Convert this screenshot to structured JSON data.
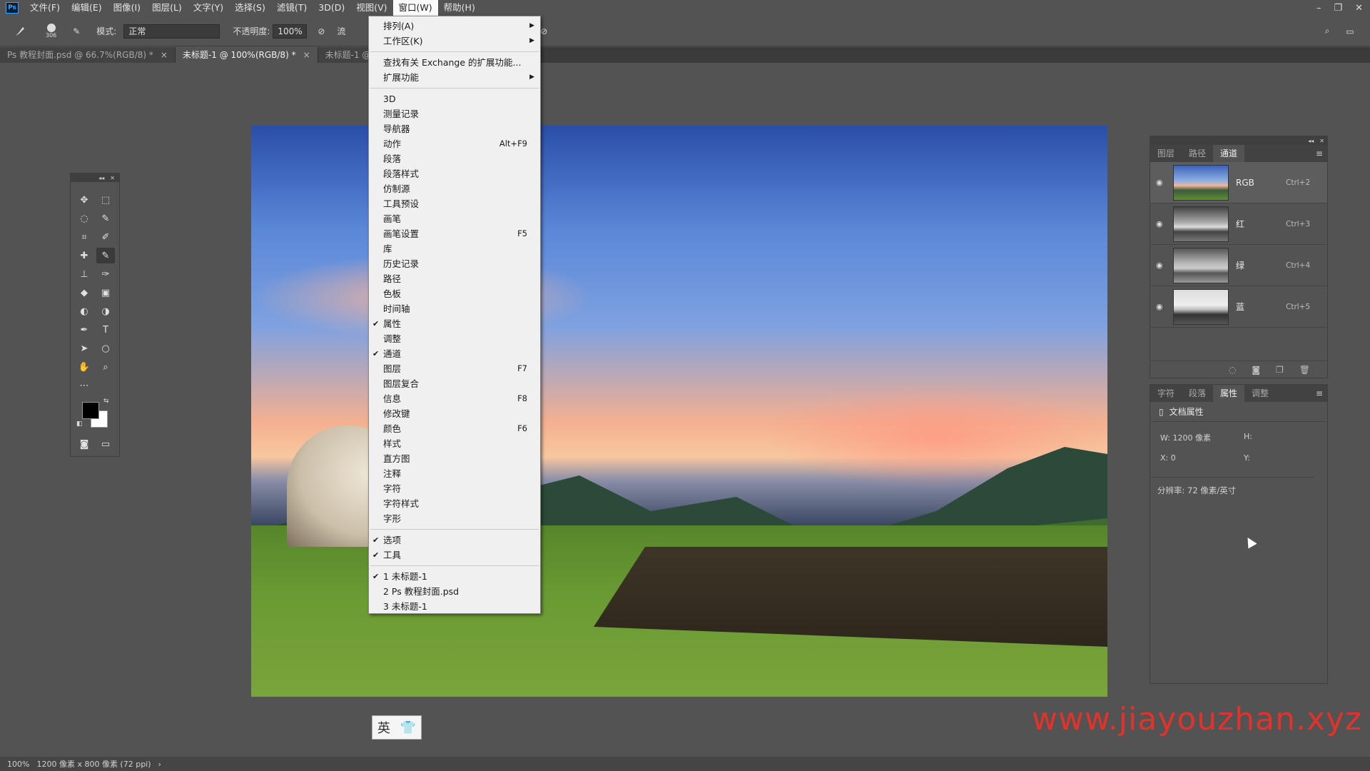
{
  "menubar": {
    "logo": "Ps",
    "items": [
      "文件(F)",
      "编辑(E)",
      "图像(I)",
      "图层(L)",
      "文字(Y)",
      "选择(S)",
      "滤镜(T)",
      "3D(D)",
      "视图(V)",
      "窗口(W)",
      "帮助(H)"
    ],
    "active_index": 9
  },
  "options": {
    "brush_size": "306",
    "mode_label": "模式:",
    "mode_value": "正常",
    "opacity_label": "不透明度:",
    "opacity_value": "100%",
    "flow_label": "流"
  },
  "tabs": [
    {
      "label": "Ps 教程封面.psd @ 66.7%(RGB/8) *",
      "active": false
    },
    {
      "label": "未标题-1 @ 100%(RGB/8) *",
      "active": true
    },
    {
      "label": "未标题-1 @ 10",
      "active": false
    }
  ],
  "dropdown": {
    "items": [
      {
        "label": "排列(A)",
        "submenu": true
      },
      {
        "label": "工作区(K)",
        "submenu": true
      },
      {
        "sep": true
      },
      {
        "label": "查找有关 Exchange 的扩展功能..."
      },
      {
        "label": "扩展功能",
        "submenu": true
      },
      {
        "sep": true
      },
      {
        "label": "3D"
      },
      {
        "label": "测量记录"
      },
      {
        "label": "导航器"
      },
      {
        "label": "动作",
        "shortcut": "Alt+F9"
      },
      {
        "label": "段落"
      },
      {
        "label": "段落样式"
      },
      {
        "label": "仿制源"
      },
      {
        "label": "工具预设"
      },
      {
        "label": "画笔"
      },
      {
        "label": "画笔设置",
        "shortcut": "F5"
      },
      {
        "label": "库"
      },
      {
        "label": "历史记录"
      },
      {
        "label": "路径"
      },
      {
        "label": "色板"
      },
      {
        "label": "时间轴"
      },
      {
        "label": "属性",
        "checked": true
      },
      {
        "label": "调整"
      },
      {
        "label": "通道",
        "checked": true
      },
      {
        "label": "图层",
        "shortcut": "F7"
      },
      {
        "label": "图层复合"
      },
      {
        "label": "信息",
        "shortcut": "F8"
      },
      {
        "label": "修改键"
      },
      {
        "label": "颜色",
        "shortcut": "F6"
      },
      {
        "label": "样式"
      },
      {
        "label": "直方图"
      },
      {
        "label": "注释"
      },
      {
        "label": "字符"
      },
      {
        "label": "字符样式"
      },
      {
        "label": "字形"
      },
      {
        "sep": true
      },
      {
        "label": "选项",
        "checked": true
      },
      {
        "label": "工具",
        "checked": true
      },
      {
        "sep": true
      },
      {
        "label": "1 未标题-1",
        "checked": true
      },
      {
        "label": "2 Ps 教程封面.psd"
      },
      {
        "label": "3 未标题-1"
      }
    ]
  },
  "channels_panel": {
    "tabs": [
      "图层",
      "路径",
      "通道"
    ],
    "active_tab": 2,
    "channels": [
      {
        "name": "RGB",
        "shortcut": "Ctrl+2"
      },
      {
        "name": "红",
        "shortcut": "Ctrl+3"
      },
      {
        "name": "绿",
        "shortcut": "Ctrl+4"
      },
      {
        "name": "蓝",
        "shortcut": "Ctrl+5"
      }
    ]
  },
  "props_panel": {
    "tabs": [
      "字符",
      "段落",
      "属性",
      "调整"
    ],
    "active_tab": 2,
    "title": "文档属性",
    "w_label": "W:",
    "w_value": "1200 像素",
    "h_label": "H:",
    "x_label": "X:",
    "x_value": "0",
    "y_label": "Y:",
    "resolution": "分辨率: 72 像素/英寸"
  },
  "statusbar": {
    "zoom": "100%",
    "doc_info": "1200 像素 x 800 像素 (72 ppi)"
  },
  "ime": {
    "lang": "英",
    "icon": "shirt-icon"
  },
  "watermark": "www.jiayouzhan.xyz"
}
